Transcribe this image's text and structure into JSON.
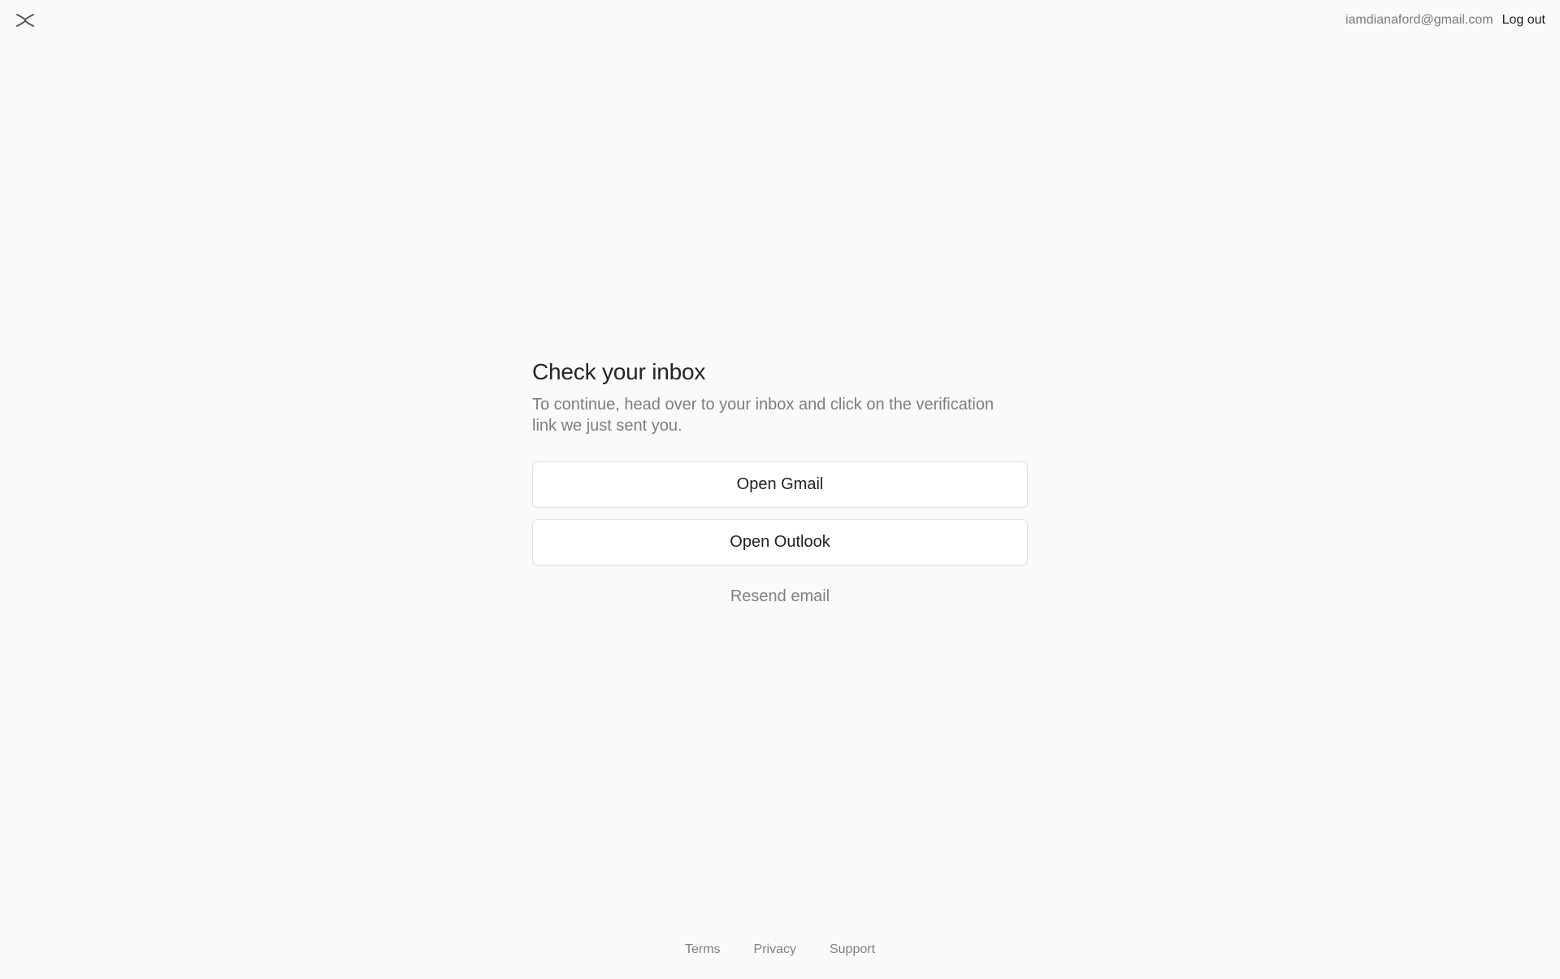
{
  "header": {
    "logo_icon": "x-logo-icon",
    "user_email": "iamdianaford@gmail.com",
    "logout_label": "Log out"
  },
  "main": {
    "title": "Check your inbox",
    "subtitle": "To continue, head over to your inbox and click on the verification link we just sent you.",
    "open_gmail_label": "Open Gmail",
    "open_outlook_label": "Open Outlook",
    "resend_label": "Resend email"
  },
  "footer": {
    "links": [
      {
        "label": "Terms"
      },
      {
        "label": "Privacy"
      },
      {
        "label": "Support"
      }
    ]
  },
  "colors": {
    "background": "#fafafa",
    "text_primary": "#242424",
    "text_muted": "#7d7d7d",
    "button_bg": "#ffffff",
    "button_border": "#e2e2e2"
  }
}
